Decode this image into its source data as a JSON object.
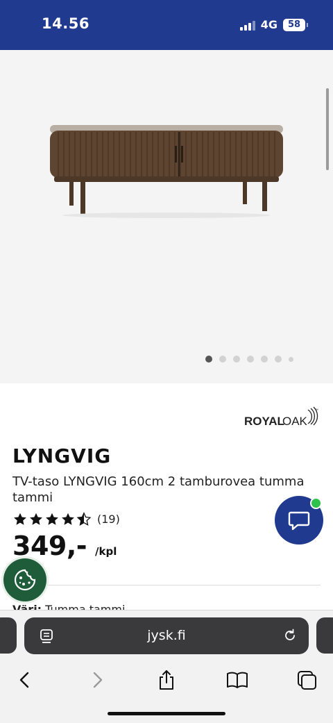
{
  "status_bar": {
    "time": "14.56",
    "network": "4G",
    "battery": "58"
  },
  "gallery": {
    "image_alt": "LYNGVIG TV-taso",
    "slide_count": 7,
    "active_slide": 1
  },
  "brand": {
    "word1": "ROYAL",
    "word2": "OAK",
    "mark": "™"
  },
  "product": {
    "name": "LYNGVIG",
    "description": "TV-taso LYNGVIG 160cm 2 tamburovea tumma tammi",
    "rating": 4.5,
    "review_count": "(19)",
    "price": "349,-",
    "unit": "/kpl",
    "color_label": "Väri:",
    "color_value": "Tumma tammi"
  },
  "browser": {
    "url": "jysk.fi"
  },
  "colors": {
    "brand_blue": "#1f3a8f",
    "online_green": "#2cc24b",
    "cookie_green": "#1f5d3a"
  },
  "icons": [
    "signal-icon",
    "battery-icon",
    "chat-icon",
    "cookie-icon",
    "page-menu-icon",
    "reload-icon",
    "back-icon",
    "forward-icon",
    "share-icon",
    "bookmarks-icon",
    "tabs-icon"
  ]
}
